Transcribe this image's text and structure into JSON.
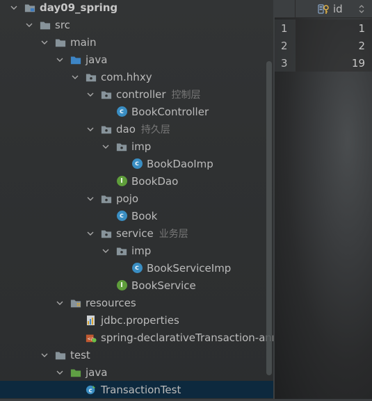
{
  "project_tree": {
    "items": [
      {
        "label": "day09_spring",
        "hint": "",
        "icon": "module-folder-icon",
        "expanded": true,
        "bold": true
      },
      {
        "label": "src",
        "hint": "",
        "icon": "folder-icon",
        "expanded": true
      },
      {
        "label": "main",
        "hint": "",
        "icon": "folder-icon",
        "expanded": true
      },
      {
        "label": "java",
        "hint": "",
        "icon": "source-root-folder-icon",
        "expanded": true
      },
      {
        "label": "com.hhxy",
        "hint": "",
        "icon": "package-icon",
        "expanded": true
      },
      {
        "label": "controller",
        "hint": "控制层",
        "icon": "package-icon",
        "expanded": true
      },
      {
        "label": "BookController",
        "hint": "",
        "icon": "class-icon",
        "expanded": null
      },
      {
        "label": "dao",
        "hint": "持久层",
        "icon": "package-icon",
        "expanded": true
      },
      {
        "label": "imp",
        "hint": "",
        "icon": "package-icon",
        "expanded": true
      },
      {
        "label": "BookDaoImp",
        "hint": "",
        "icon": "class-icon",
        "expanded": null
      },
      {
        "label": "BookDao",
        "hint": "",
        "icon": "interface-icon",
        "expanded": null
      },
      {
        "label": "pojo",
        "hint": "",
        "icon": "package-icon",
        "expanded": true
      },
      {
        "label": "Book",
        "hint": "",
        "icon": "class-icon",
        "expanded": null
      },
      {
        "label": "service",
        "hint": "业务层",
        "icon": "package-icon",
        "expanded": true
      },
      {
        "label": "imp",
        "hint": "",
        "icon": "package-icon",
        "expanded": true
      },
      {
        "label": "BookServiceImp",
        "hint": "",
        "icon": "class-icon",
        "expanded": null
      },
      {
        "label": "BookService",
        "hint": "",
        "icon": "interface-icon",
        "expanded": null
      },
      {
        "label": "resources",
        "hint": "",
        "icon": "resources-folder-icon",
        "expanded": true
      },
      {
        "label": "jdbc.properties",
        "hint": "",
        "icon": "properties-file-icon",
        "expanded": null
      },
      {
        "label": "spring-declarativeTransaction-annotation.xml",
        "hint": "",
        "icon": "spring-xml-icon",
        "expanded": null
      },
      {
        "label": "test",
        "hint": "",
        "icon": "folder-icon",
        "expanded": true
      },
      {
        "label": "java",
        "hint": "",
        "icon": "test-source-folder-icon",
        "expanded": true
      },
      {
        "label": "TransactionTest",
        "hint": "",
        "icon": "test-class-icon",
        "expanded": null,
        "selected": true
      }
    ]
  },
  "data_grid": {
    "column_title": "id",
    "rows": [
      {
        "row_number": "1",
        "id": "1"
      },
      {
        "row_number": "2",
        "id": "2"
      },
      {
        "row_number": "3",
        "id": "19"
      }
    ]
  },
  "colors": {
    "class_icon": "#3a8ec3",
    "interface_icon": "#5f9e3b",
    "selected_row": "#0d293e",
    "hint_text": "#787878"
  }
}
